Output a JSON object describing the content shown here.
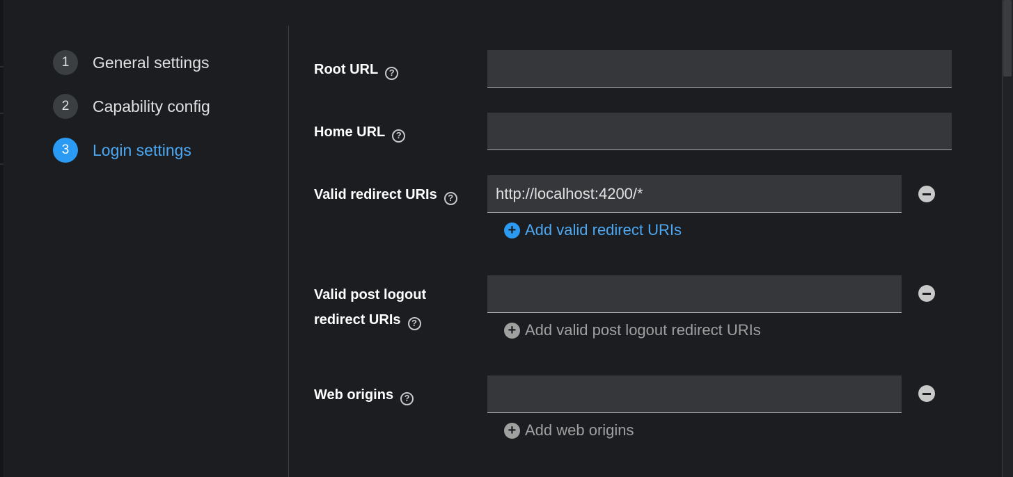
{
  "wizard": {
    "steps": [
      {
        "number": "1",
        "label": "General settings"
      },
      {
        "number": "2",
        "label": "Capability config"
      },
      {
        "number": "3",
        "label": "Login settings"
      }
    ]
  },
  "form": {
    "root_url": {
      "label": "Root URL",
      "value": ""
    },
    "home_url": {
      "label": "Home URL",
      "value": ""
    },
    "valid_redirect_uris": {
      "label": "Valid redirect URIs",
      "value": "http://localhost:4200/*",
      "add_label": "Add valid redirect URIs"
    },
    "valid_post_logout": {
      "label_line1": "Valid post logout",
      "label_line2": "redirect URIs",
      "value": "",
      "add_label": "Add valid post logout redirect URIs"
    },
    "web_origins": {
      "label": "Web origins",
      "value": "",
      "add_label": "Add web origins"
    }
  },
  "icons": {
    "help": "help-icon",
    "add": "plus-circle-icon",
    "remove": "minus-circle-icon"
  },
  "colors": {
    "background": "#1b1d21",
    "accent": "#2b9af3",
    "input_bg": "#36373a"
  }
}
